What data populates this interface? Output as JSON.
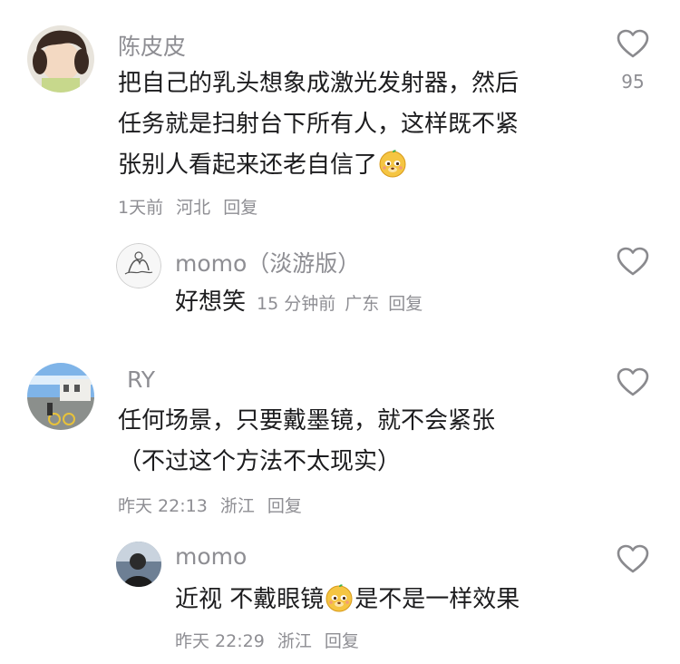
{
  "comments": [
    {
      "user": "陈皮皮",
      "lines": [
        "把自己的乳头想象成激光发射器，然后",
        "任务就是扫射台下所有人，这样既不紧",
        "张别人看起来还老自信了"
      ],
      "emoji": "doge-emoji",
      "time": "1天前",
      "location": "河北",
      "reply_label": "回复",
      "likes": "95"
    },
    {
      "user": "momo（淡游版）",
      "text": "好想笑",
      "time": "15 分钟前",
      "location": "广东",
      "reply_label": "回复"
    },
    {
      "user": "RY",
      "lines": [
        "任何场景，只要戴墨镜，就不会紧张",
        "（不过这个方法不太现实）"
      ],
      "time": "昨天 22:13",
      "location": "浙江",
      "reply_label": "回复"
    },
    {
      "user": "momo",
      "text_before": "近视 不戴眼镜",
      "emoji": "doge-emoji",
      "text_after": "是不是一样效果",
      "time": "昨天 22:29",
      "location": "浙江",
      "reply_label": "回复"
    }
  ],
  "icons": {
    "like": "heart-outline-icon",
    "emoji": "doge-emoji"
  },
  "colors": {
    "secondary_text": "#8e8e93",
    "primary_text": "#1c1c1e"
  }
}
